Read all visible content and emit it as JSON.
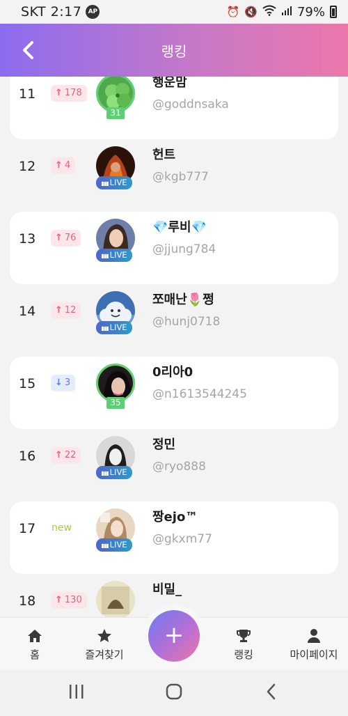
{
  "status": {
    "carrier": "SKT 2:17",
    "ap_badge": "AP",
    "battery": "79%"
  },
  "header": {
    "title": "랭킹"
  },
  "rows": [
    {
      "rank": "11",
      "change": "178",
      "dir": "up",
      "name": "행운맘",
      "handle": "@goddnsaka",
      "tag": "31",
      "tagType": "level",
      "card": true,
      "avatar": "clover"
    },
    {
      "rank": "12",
      "change": "4",
      "dir": "up",
      "name": "헌트",
      "handle": "@kgb777",
      "tag": "LIVE",
      "tagType": "live",
      "card": false,
      "avatar": "fire"
    },
    {
      "rank": "13",
      "change": "76",
      "dir": "up",
      "name": "💎루비💎",
      "handle": "@jjung784",
      "tag": "LIVE",
      "tagType": "live",
      "card": true,
      "avatar": "girl"
    },
    {
      "rank": "14",
      "change": "12",
      "dir": "up",
      "name": "쪼매난🌷쩡",
      "handle": "@hunj0718",
      "tag": "LIVE",
      "tagType": "live",
      "card": false,
      "avatar": "cloud"
    },
    {
      "rank": "15",
      "change": "3",
      "dir": "down",
      "name": "0리아0",
      "handle": "@n1613544245",
      "tag": "35",
      "tagType": "level",
      "card": true,
      "avatar": "dark"
    },
    {
      "rank": "16",
      "change": "22",
      "dir": "up",
      "name": "정민",
      "handle": "@ryo888",
      "tag": "LIVE",
      "tagType": "live",
      "card": false,
      "avatar": "bw"
    },
    {
      "rank": "17",
      "change": "new",
      "dir": "new",
      "name": "짱ejo™",
      "handle": "@gkxm77",
      "tag": "LIVE",
      "tagType": "live",
      "card": true,
      "avatar": "beige"
    },
    {
      "rank": "18",
      "change": "130",
      "dir": "up",
      "name": "비밀_",
      "handle": "",
      "tag": "",
      "tagType": "none",
      "card": false,
      "avatar": "poster"
    }
  ],
  "nav": {
    "home": "홈",
    "favorites": "즐겨찾기",
    "fab": "+",
    "ranking": "랭킹",
    "mypage": "마이페이지"
  },
  "colors": {
    "accent_start": "#8b6cef",
    "accent_end": "#ec77ab",
    "up": "#e8607c",
    "down": "#5a7fe0",
    "new": "#a6c94a",
    "level": "#5fcf73"
  }
}
